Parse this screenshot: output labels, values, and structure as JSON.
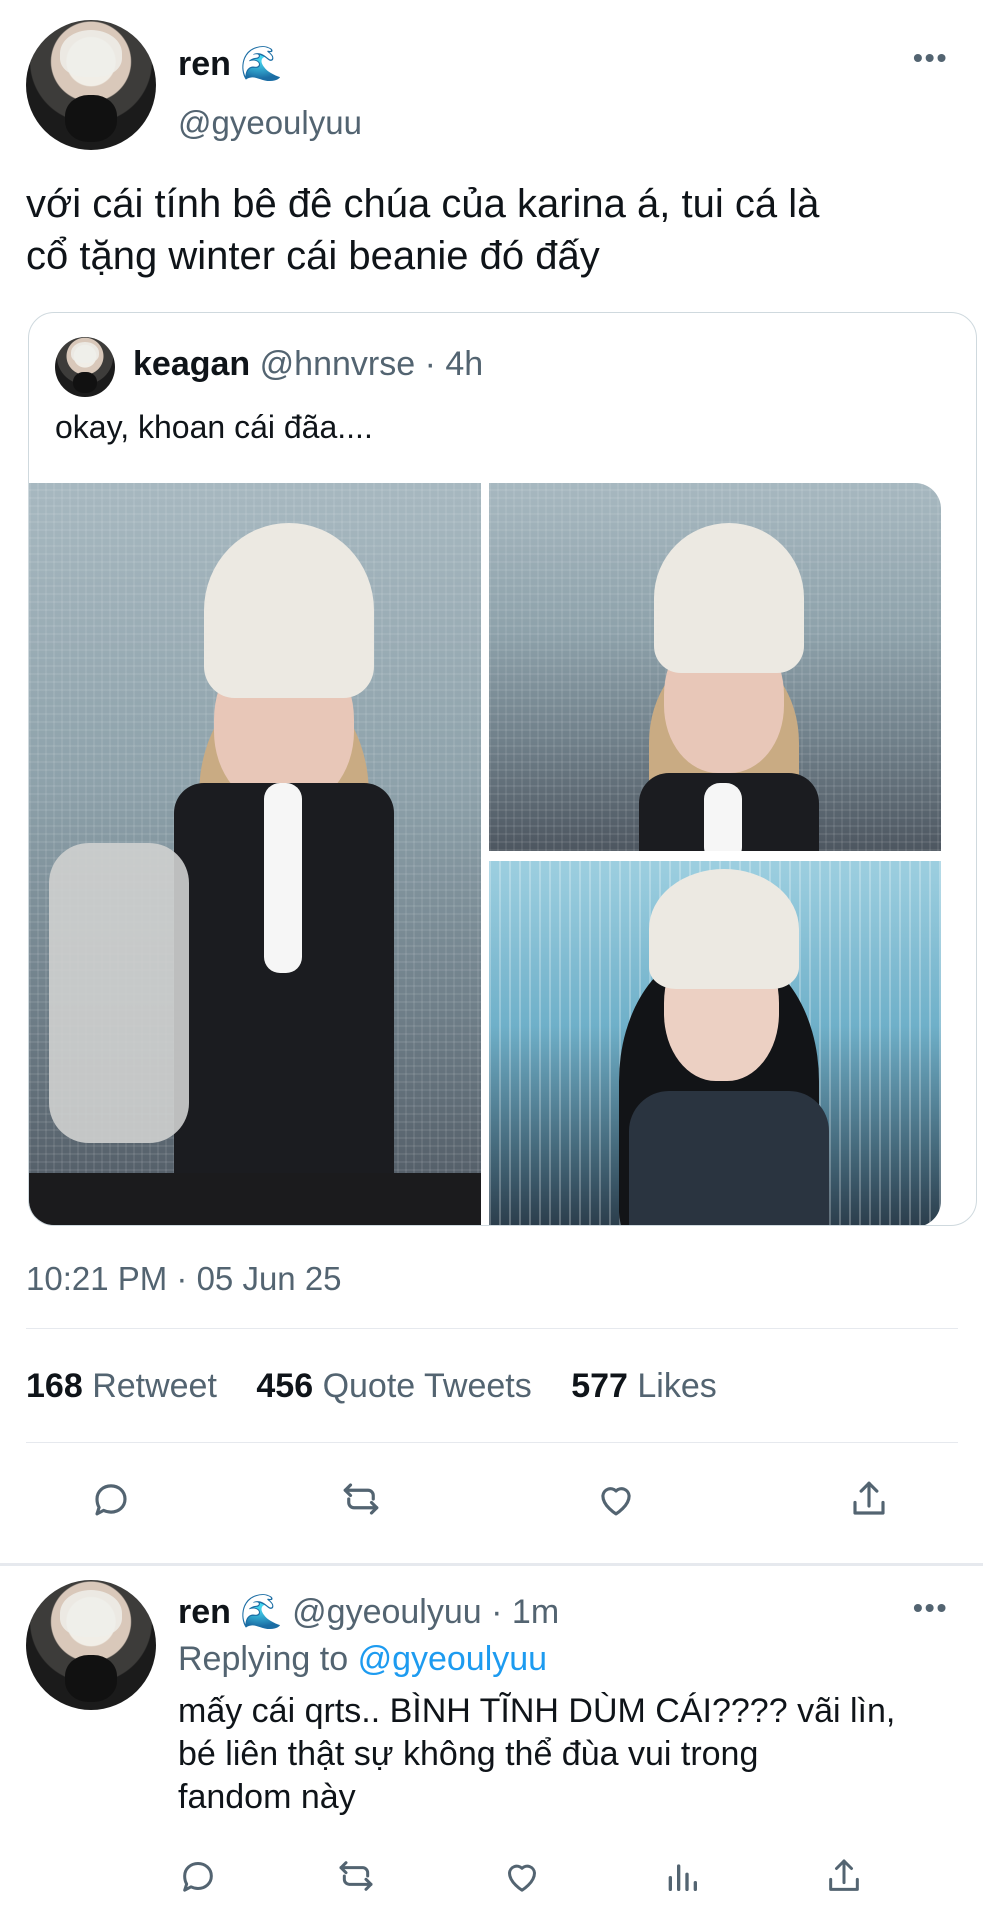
{
  "main_tweet": {
    "author_name": "ren 🌊",
    "author_handle": "@gyeoulyuu",
    "text_line1": "với cái tính bê đê chúa của karina á, tui cá là",
    "text_line2": "cổ tặng winter cái beanie đó đấy",
    "quoted": {
      "author_name": "keagan",
      "author_handle": "@hnnvrse",
      "separator": "·",
      "time": "4h",
      "text": "okay, khoan cái đãa...."
    },
    "timestamp": "10:21 PM · 05 Jun 25",
    "stats": [
      {
        "count": "168",
        "label": "Retweet"
      },
      {
        "count": "456",
        "label": "Quote Tweets"
      },
      {
        "count": "577",
        "label": "Likes"
      }
    ],
    "actions": [
      "reply-icon",
      "retweet-icon",
      "like-icon",
      "share-icon"
    ]
  },
  "reply_tweet": {
    "author_name": "ren 🌊",
    "author_handle": "@gyeoulyuu",
    "separator": "·",
    "time": "1m",
    "replying_prefix": "Replying to",
    "replying_to": "@gyeoulyuu",
    "text_line1": "mấy cái qrts.. BÌNH TĨNH DÙM CÁI???? vãi lìn,",
    "text_line2": "bé liên thật sự không thể đùa vui trong",
    "text_line3": "fandom này",
    "actions": [
      "reply-icon",
      "retweet-icon",
      "like-icon",
      "analytics-icon",
      "share-icon"
    ]
  },
  "colors": {
    "text": "#0f1419",
    "muted": "#536471",
    "link": "#1d9bf0",
    "divider": "#e6e9ee"
  }
}
